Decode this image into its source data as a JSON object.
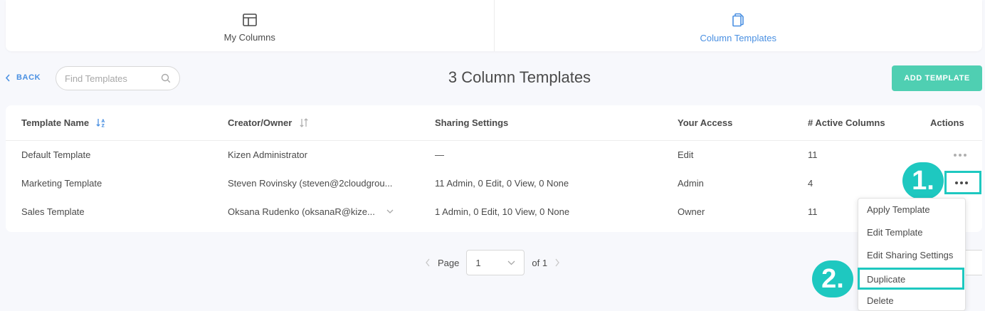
{
  "tabs": [
    {
      "label": "My Columns",
      "active": false
    },
    {
      "label": "Column Templates",
      "active": true
    }
  ],
  "toolbar": {
    "back_label": "BACK",
    "search_placeholder": "Find Templates",
    "title": "3 Column Templates",
    "add_label": "ADD TEMPLATE"
  },
  "table": {
    "headers": [
      "Template Name",
      "Creator/Owner",
      "Sharing Settings",
      "Your Access",
      "# Active Columns",
      "Actions"
    ],
    "rows": [
      {
        "name": "Default Template",
        "owner": "Kizen Administrator",
        "sharing": "—",
        "access": "Edit",
        "active": "11"
      },
      {
        "name": "Marketing Template",
        "owner": "Steven Rovinsky (steven@2cloudgrou...",
        "sharing": "11 Admin, 0 Edit, 0 View, 0 None",
        "access": "Admin",
        "active": "4"
      },
      {
        "name": "Sales Template",
        "owner": "Oksana Rudenko (oksanaR@kize...",
        "sharing": "1 Admin, 0 Edit, 10 View, 0 None",
        "access": "Owner",
        "active": "11"
      }
    ]
  },
  "pagination": {
    "page_label": "Page",
    "page_value": "1",
    "of_label": "of 1"
  },
  "menu": {
    "items": [
      "Apply Template",
      "Edit Template",
      "Edit Sharing Settings",
      "Duplicate",
      "Delete"
    ]
  },
  "markers": {
    "step1": "1.",
    "step2": "2."
  },
  "colors": {
    "accent_blue": "#4a90e2",
    "teal_button": "#4fcfb2",
    "highlight": "#1ec8c0",
    "text": "#4a4a4a"
  }
}
